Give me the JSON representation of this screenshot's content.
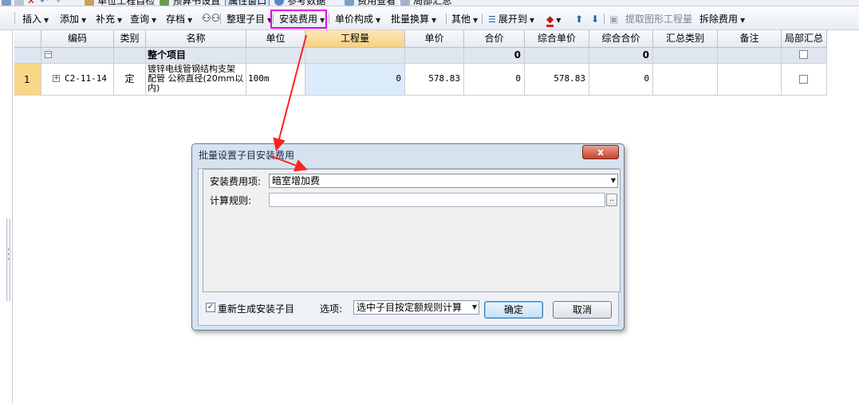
{
  "top_toolbar": {
    "items": [
      "单位工程自检",
      "预算书设置",
      "属性窗口",
      "参考数据",
      "费用查看",
      "局部汇总"
    ]
  },
  "toolbar": {
    "insert": "插入",
    "add": "添加",
    "supplement": "补充",
    "query": "查询",
    "archive": "存档",
    "organize": "整理子目",
    "install_fee": "安装费用",
    "unit_price": "单价构成",
    "batch": "批量换算",
    "other": "其他",
    "expand": "展开到",
    "extract": "提取图形工程量",
    "split": "拆除费用"
  },
  "grid": {
    "headers": [
      "编码",
      "类别",
      "名称",
      "单位",
      "工程量",
      "单价",
      "合价",
      "综合单价",
      "综合合价",
      "汇总类别",
      "备注",
      "局部汇总"
    ],
    "project_row": {
      "name": "整个项目",
      "total": "0",
      "composite_total": "0"
    },
    "rows": [
      {
        "index": "1",
        "code": "C2-11-14",
        "type": "定",
        "name_line1": "镀锌电线管钢结构支架",
        "name_line2": "配管 公称直径(20mm以",
        "name_line3": "内)",
        "unit": "100m",
        "quantity": "0",
        "unit_price": "578.83",
        "total": "0",
        "composite_unit_price": "578.83",
        "composite_total": "0"
      }
    ]
  },
  "dialog": {
    "title": "批量设置子目安装费用",
    "close": "x",
    "fee_item_label": "安装费用项:",
    "fee_item_value": "暗室增加费",
    "rule_label": "计算规则:",
    "rule_value": "",
    "rule_button": "..",
    "regenerate_label": "重新生成安装子目",
    "regenerate_checked": true,
    "option_label": "选项:",
    "option_value": "选中子目按定额规则计算",
    "ok": "确定",
    "cancel": "取消"
  },
  "colors": {
    "highlight": "#e600e6",
    "arrow": "#ff2020",
    "selected_header": "#f8d283",
    "row_index": "#f8d887"
  }
}
